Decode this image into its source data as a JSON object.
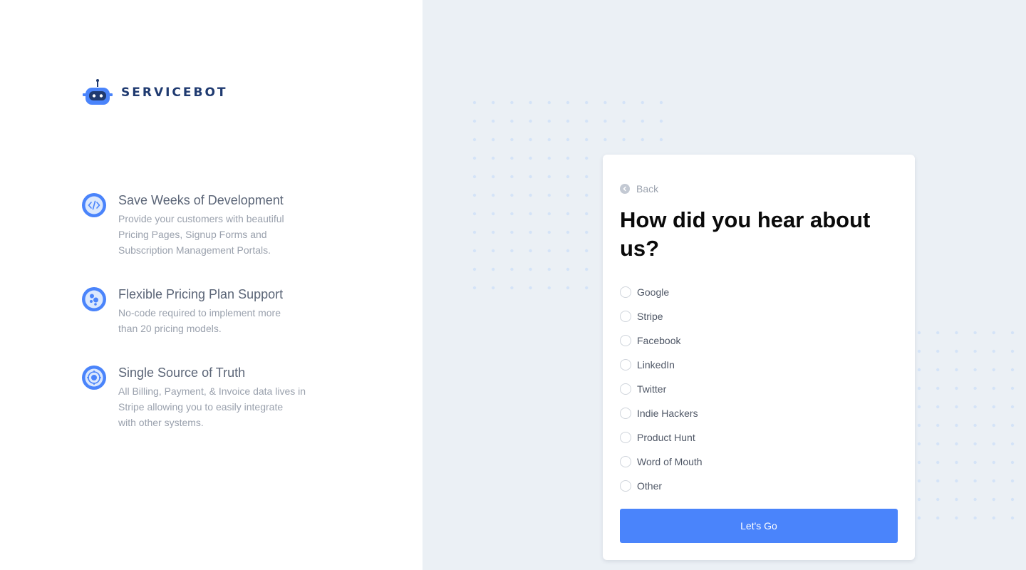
{
  "brand": {
    "name": "SERVICEBOT",
    "icon": "robot-logo-icon"
  },
  "features": [
    {
      "icon": "code-icon",
      "title": "Save Weeks of Development",
      "lines": [
        "Provide your customers with beautiful",
        "Pricing Pages, Signup Forms and",
        "Subscription Management Portals."
      ]
    },
    {
      "icon": "pricing-bubbles-icon",
      "title": "Flexible Pricing Plan Support",
      "lines": [
        "No-code required to implement more",
        "than 20 pricing models."
      ]
    },
    {
      "icon": "target-icon",
      "title": "Single Source of Truth",
      "lines": [
        "All Billing, Payment, & Invoice data lives in",
        "Stripe allowing you to easily integrate",
        "with other systems."
      ]
    }
  ],
  "survey": {
    "back_label": "Back",
    "heading": "How did you hear about us?",
    "options": [
      "Google",
      "Stripe",
      "Facebook",
      "LinkedIn",
      "Twitter",
      "Indie Hackers",
      "Product Hunt",
      "Word of Mouth",
      "Other"
    ],
    "submit_label": "Let's Go"
  },
  "colors": {
    "accent": "#4a84fb",
    "brand_navy": "#1f3a70",
    "panel_bg": "#ebf0f5",
    "dot": "#d4e3f7"
  }
}
